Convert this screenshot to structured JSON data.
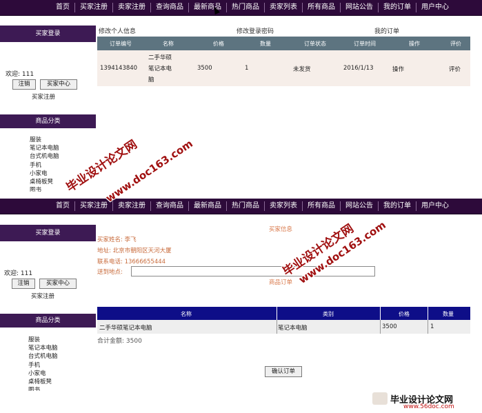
{
  "nav": {
    "items": [
      "首页",
      "买家注册",
      "卖家注册",
      "查询商品",
      "最新商品",
      "热门商品",
      "卖家列表",
      "所有商品",
      "网站公告",
      "我的订单",
      "用户中心"
    ]
  },
  "sidebar": {
    "login_title": "买家登录",
    "welcome": "欢迎: 111",
    "logout_btn": "注销",
    "center_btn": "买家中心",
    "register_link": "买家注册",
    "category_title": "商品分类",
    "categories": [
      "服装",
      "笔记本电脑",
      "台式机电脑",
      "手机",
      "小家电",
      "桌椅板凳",
      "图书"
    ]
  },
  "orders_page": {
    "links": [
      "修改个人信息",
      "修改登录密码",
      "我的订单"
    ],
    "headers": [
      "订单编号",
      "名称",
      "价格",
      "数量",
      "订单状态",
      "订单时间",
      "操作",
      "评价"
    ],
    "row": {
      "id": "1394143840",
      "name_l1": "二手华硕",
      "name_l2": "笔记本电",
      "name_l3": "脑",
      "price": "3500",
      "qty": "1",
      "status": "未发货",
      "time": "2016/1/13",
      "action": "操作",
      "review": "评价"
    }
  },
  "checkout_page": {
    "buyer_info_title": "买家信息",
    "buyer_name": "买家姓名: 李飞",
    "address": "地址: 北京市朝阳区天河大厦",
    "phone": "联系电话: 13666655444",
    "delivery_label": "送到地点:",
    "delivery_value": "",
    "goods_title": "商品订单",
    "headers": [
      "名称",
      "类别",
      "价格",
      "数量"
    ],
    "row": {
      "name": "二手华硕笔记本电脑",
      "category": "笔记本电脑",
      "price": "3500",
      "qty": "1"
    },
    "total": "合计金额: 3500",
    "confirm_btn": "确认订单"
  },
  "watermarks": {
    "w1": "毕业设计论文网",
    "w2": "www.doc163.com",
    "w3": "毕业设计论文网",
    "w4": "www.doc163.com",
    "logo_text": "毕业设计论文网",
    "logo_url": "www.56doc.com"
  },
  "colors": {
    "nav_bg": "#2d0a3a",
    "sidebar_head": "#3d1a54",
    "order_header": "#5d7480",
    "goods_header": "#0e0e88",
    "accent": "#c86a3a"
  }
}
